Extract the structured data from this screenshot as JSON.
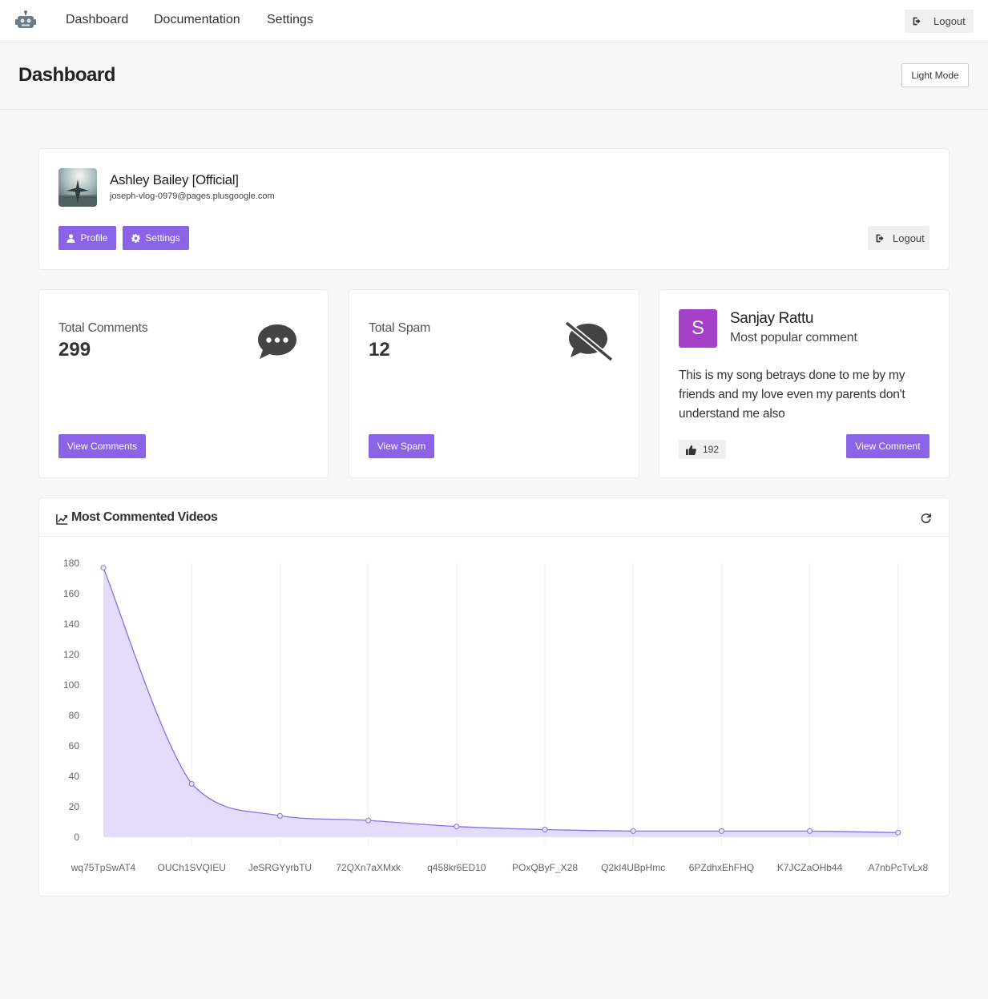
{
  "nav": {
    "links": [
      "Dashboard",
      "Documentation",
      "Settings"
    ],
    "logout_label": "Logout"
  },
  "header": {
    "title": "Dashboard",
    "theme_toggle_label": "Light Mode"
  },
  "channel": {
    "name": "Ashley Bailey [Official]",
    "email": "joseph-vlog-0979@pages.plusgoogle.com",
    "profile_label": "Profile",
    "settings_label": "Settings",
    "logout_label": "Logout"
  },
  "stats": {
    "comments": {
      "label": "Total Comments",
      "value": "299",
      "button": "View Comments",
      "icon": "comment-dots-icon"
    },
    "spam": {
      "label": "Total Spam",
      "value": "12",
      "button": "View Spam",
      "icon": "comment-slash-icon"
    }
  },
  "popular": {
    "initial": "S",
    "author": "Sanjay Rattu",
    "subtitle": "Most popular comment",
    "text": "This is my song betrays done to me by my friends and my love even my parents don't understand me also",
    "likes": "192",
    "button": "View Comment",
    "badge_color": "#a541c8"
  },
  "colors": {
    "accent": "#8a63e6",
    "series_line": "#8a6ee8",
    "series_fill": "#e4dcfb"
  },
  "chart_panel": {
    "title": "Most Commented Videos"
  },
  "chart_data": {
    "type": "area",
    "title": "Most Commented Videos",
    "categories": [
      "wq75TpSwAT4",
      "OUCh1SVQIEU",
      "JeSRGYyrbTU",
      "72QXn7aXMxk",
      "q458kr6ED10",
      "POxQByF_X28",
      "Q2kI4UBpHmc",
      "6PZdhxEhFHQ",
      "K7JCZaOHb44",
      "A7nbPcTvLx8"
    ],
    "values": [
      177,
      35,
      14,
      11,
      7,
      5,
      4,
      4,
      4,
      3
    ],
    "y_ticks": [
      0,
      20,
      40,
      60,
      80,
      100,
      120,
      140,
      160,
      180
    ],
    "ylim": [
      0,
      180
    ],
    "xlabel": "",
    "ylabel": "",
    "grid": "vertical",
    "legend": "none"
  }
}
